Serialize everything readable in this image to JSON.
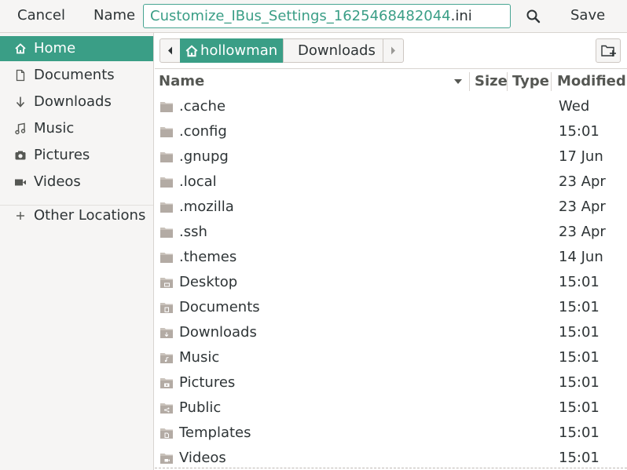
{
  "header": {
    "cancel_label": "Cancel",
    "name_label": "Name",
    "filename_base": "Customize_IBus_Settings_1625468482044",
    "filename_ext": ".ini",
    "save_label": "Save"
  },
  "sidebar": {
    "items": [
      {
        "label": "Home",
        "icon": "home-icon"
      },
      {
        "label": "Documents",
        "icon": "document-icon"
      },
      {
        "label": "Downloads",
        "icon": "download-icon"
      },
      {
        "label": "Music",
        "icon": "music-icon"
      },
      {
        "label": "Pictures",
        "icon": "camera-icon"
      },
      {
        "label": "Videos",
        "icon": "video-icon"
      }
    ],
    "other_locations": "Other Locations"
  },
  "pathbar": {
    "home": "hollowman",
    "current": "Downloads"
  },
  "columns": {
    "name": "Name",
    "size": "Size",
    "type": "Type",
    "modified": "Modified"
  },
  "files": [
    {
      "name": ".cache",
      "modified": "Wed",
      "icon": "folder-icon"
    },
    {
      "name": ".config",
      "modified": "15:01",
      "icon": "folder-icon"
    },
    {
      "name": ".gnupg",
      "modified": "17 Jun",
      "icon": "folder-icon"
    },
    {
      "name": ".local",
      "modified": "23 Apr",
      "icon": "folder-icon"
    },
    {
      "name": ".mozilla",
      "modified": "23 Apr",
      "icon": "folder-icon"
    },
    {
      "name": ".ssh",
      "modified": "23 Apr",
      "icon": "folder-icon"
    },
    {
      "name": ".themes",
      "modified": "14 Jun",
      "icon": "folder-icon"
    },
    {
      "name": "Desktop",
      "modified": "15:01",
      "icon": "folder-desktop-icon"
    },
    {
      "name": "Documents",
      "modified": "15:01",
      "icon": "folder-documents-icon"
    },
    {
      "name": "Downloads",
      "modified": "15:01",
      "icon": "folder-download-icon"
    },
    {
      "name": "Music",
      "modified": "15:01",
      "icon": "folder-music-icon"
    },
    {
      "name": "Pictures",
      "modified": "15:01",
      "icon": "folder-pictures-icon"
    },
    {
      "name": "Public",
      "modified": "15:01",
      "icon": "folder-public-icon"
    },
    {
      "name": "Templates",
      "modified": "15:01",
      "icon": "folder-templates-icon"
    },
    {
      "name": "Videos",
      "modified": "15:01",
      "icon": "folder-videos-icon"
    }
  ],
  "colors": {
    "accent": "#3a9e86",
    "text": "#2e3436",
    "sidebar_bg": "#f6f5f4"
  }
}
